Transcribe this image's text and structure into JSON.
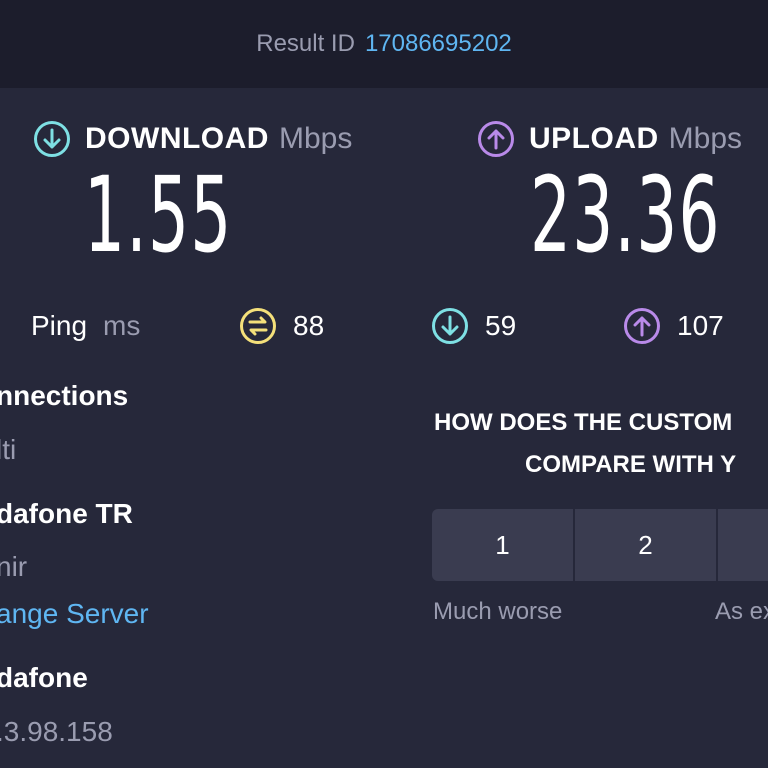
{
  "header": {
    "result_label": "Result ID",
    "result_id": "17086695202"
  },
  "download": {
    "label": "DOWNLOAD",
    "unit": "Mbps",
    "value": "1.55",
    "icon": "arrow-down-circle-icon",
    "color": "#7ee0e4"
  },
  "upload": {
    "label": "UPLOAD",
    "unit": "Mbps",
    "value": "23.36",
    "icon": "arrow-up-circle-icon",
    "color": "#b98ae9"
  },
  "ping": {
    "label": "Ping",
    "unit": "ms",
    "idle": {
      "value": "88",
      "color": "#f4e07a"
    },
    "download": {
      "value": "59",
      "color": "#7ee0e4"
    },
    "upload": {
      "value": "107",
      "color": "#b98ae9"
    }
  },
  "details": {
    "connections_label": "nnections",
    "connections_value": "lti",
    "isp": "dafone TR",
    "location": "nir",
    "change_server": "ange Server",
    "server": "dafone",
    "ip": ".3.98.158"
  },
  "survey": {
    "question_line1": "HOW DOES THE CUSTOM",
    "question_line2": "COMPARE WITH Y",
    "options": [
      "1",
      "2",
      ""
    ],
    "low_label": "Much worse",
    "mid_label": "As ex"
  }
}
